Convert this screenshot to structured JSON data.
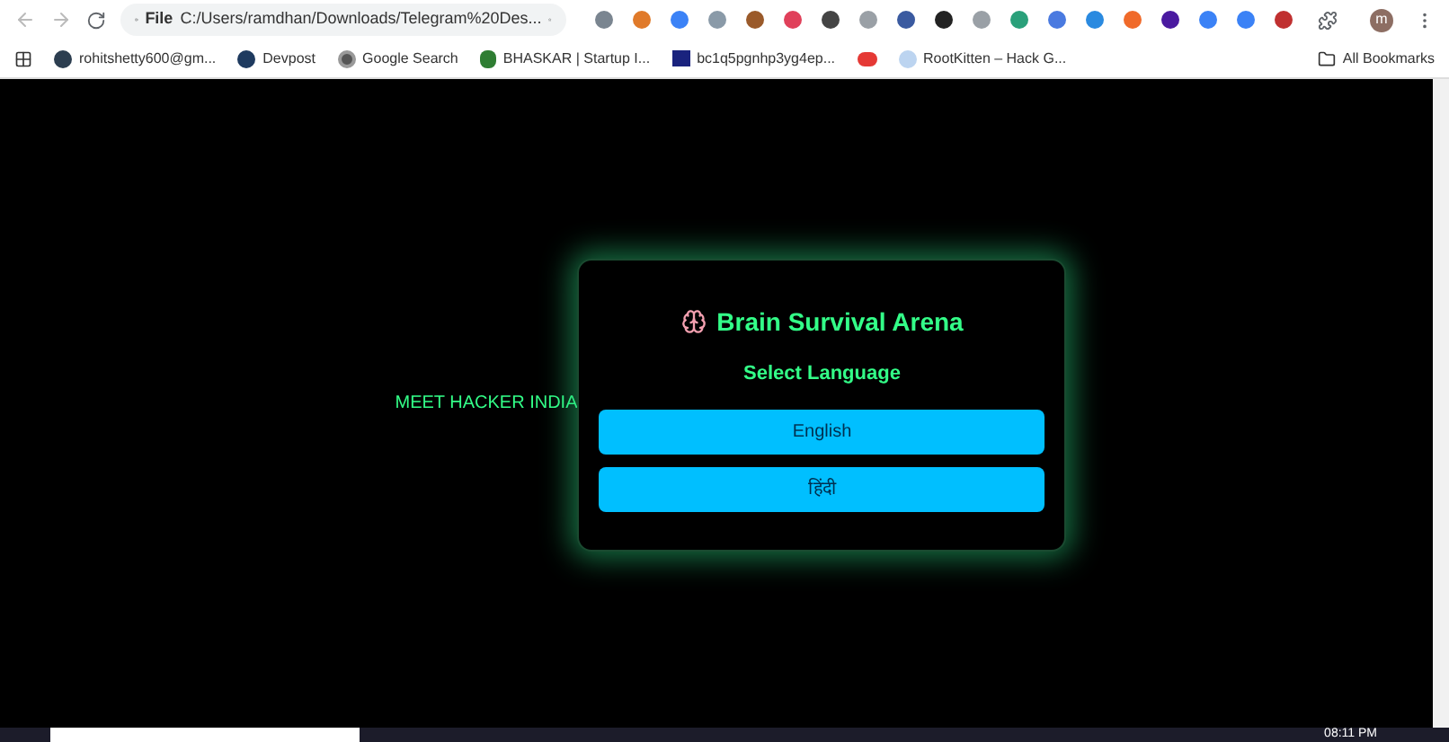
{
  "browser": {
    "address_chip": "File",
    "address": "C:/Users/ramdhan/Downloads/Telegram%20Des...",
    "profile_initial": "m"
  },
  "bookmarks": [
    {
      "kind": "labeled",
      "label": "rohitshetty600@gm..."
    },
    {
      "kind": "labeled",
      "label": "Devpost"
    },
    {
      "kind": "labeled",
      "label": "Google Search"
    },
    {
      "kind": "labeled",
      "label": "BHASKAR | Startup I..."
    },
    {
      "kind": "labeled",
      "label": "bc1q5pgnhp3yg4ep..."
    },
    {
      "kind": "icon_only"
    },
    {
      "kind": "labeled",
      "label": "RootKitten – Hack G..."
    }
  ],
  "all_bookmarks": "All Bookmarks",
  "page": {
    "side_text": "MEET HACKER INDIA",
    "modal": {
      "title": "Brain Survival Arena",
      "subtitle": "Select Language",
      "options": [
        {
          "label": "English"
        },
        {
          "label": "हिंदी"
        }
      ]
    }
  },
  "taskbar": {
    "time": "08:11 PM"
  }
}
